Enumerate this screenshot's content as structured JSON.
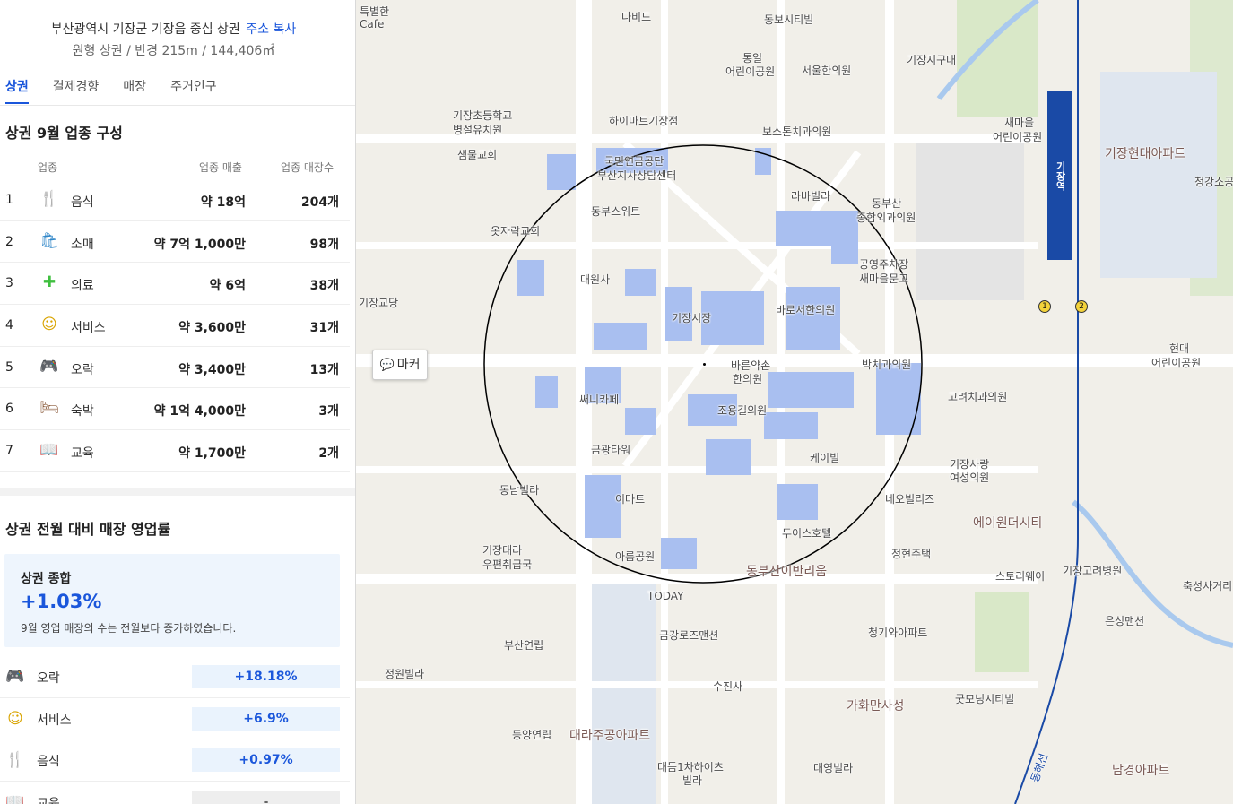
{
  "panel": {
    "address": "부산광역시 기장군 기장읍 중심 상권",
    "copy_label": "주소 복사",
    "subtitle": "원형 상권 / 반경 215m / 144,406㎡",
    "tabs": [
      {
        "label": "상권",
        "active": true
      },
      {
        "label": "결제경향",
        "active": false
      },
      {
        "label": "매장",
        "active": false
      },
      {
        "label": "주거인구",
        "active": false
      }
    ],
    "composition": {
      "title": "상권 9월 업종 구성",
      "headers": {
        "category": "업종",
        "sales": "업종 매출",
        "stores": "업종 매장수"
      },
      "rows": [
        {
          "rank": "1",
          "icon": "food-icon",
          "glyph": "🍴",
          "name": "음식",
          "sales": "약 18억",
          "stores": "204개"
        },
        {
          "rank": "2",
          "icon": "shopping-bag-icon",
          "glyph": "🛍",
          "name": "소매",
          "sales": "약 7억 1,000만",
          "stores": "98개"
        },
        {
          "rank": "3",
          "icon": "medical-cross-icon",
          "glyph": "✚",
          "name": "의료",
          "sales": "약 6억",
          "stores": "38개"
        },
        {
          "rank": "4",
          "icon": "smiley-icon",
          "glyph": "☺",
          "name": "서비스",
          "sales": "약 3,600만",
          "stores": "31개"
        },
        {
          "rank": "5",
          "icon": "gamepad-icon",
          "glyph": "🎮",
          "name": "오락",
          "sales": "약 3,400만",
          "stores": "13개"
        },
        {
          "rank": "6",
          "icon": "bed-icon",
          "glyph": "🛏",
          "name": "숙박",
          "sales": "약 1억 4,000만",
          "stores": "3개"
        },
        {
          "rank": "7",
          "icon": "book-icon",
          "glyph": "📖",
          "name": "교육",
          "sales": "약 1,700만",
          "stores": "2개"
        }
      ]
    },
    "operating": {
      "title": "상권 전월 대비 매장 영업률",
      "summary_title": "상권 종합",
      "summary_value": "+1.03%",
      "summary_desc": "9월 영업 매장의 수는 전월보다 증가하였습니다.",
      "rows": [
        {
          "icon": "gamepad-icon",
          "glyph": "🎮",
          "name": "오락",
          "value": "+18.18%"
        },
        {
          "icon": "smiley-icon",
          "glyph": "☺",
          "name": "서비스",
          "value": "+6.9%"
        },
        {
          "icon": "food-icon",
          "glyph": "🍴",
          "name": "음식",
          "value": "+0.97%"
        },
        {
          "icon": "book-icon",
          "glyph": "📖",
          "name": "교육",
          "value": "-"
        }
      ]
    }
  },
  "map": {
    "marker_button": "마커",
    "station_name": "기장역",
    "exits": [
      "1",
      "2"
    ],
    "labels": [
      {
        "text": "특별한",
        "big": false
      },
      {
        "text": "Cafe",
        "big": false
      },
      {
        "text": "다비드",
        "big": false
      },
      {
        "text": "동보시티빌",
        "big": false
      },
      {
        "text": "통일",
        "big": false
      },
      {
        "text": "어린이공원",
        "big": false
      },
      {
        "text": "서울한의원",
        "big": false
      },
      {
        "text": "기장지구대",
        "big": false
      },
      {
        "text": "기장초등학교",
        "big": false
      },
      {
        "text": "병설유치원",
        "big": false
      },
      {
        "text": "하이마트기장점",
        "big": false
      },
      {
        "text": "보스톤치과의원",
        "big": false
      },
      {
        "text": "새마을",
        "big": false
      },
      {
        "text": "어린이공원",
        "big": false
      },
      {
        "text": "기장현대아파트",
        "big": true
      },
      {
        "text": "청강소공",
        "big": false
      },
      {
        "text": "샘물교회",
        "big": false
      },
      {
        "text": "국민연금공단",
        "big": false
      },
      {
        "text": "부산지사상담센터",
        "big": false
      },
      {
        "text": "라바빌라",
        "big": false
      },
      {
        "text": "동부산",
        "big": false
      },
      {
        "text": "종합외과의원",
        "big": false
      },
      {
        "text": "동부스위트",
        "big": false
      },
      {
        "text": "옷자락교회",
        "big": false
      },
      {
        "text": "공영주차장",
        "big": false
      },
      {
        "text": "새마을문고",
        "big": false
      },
      {
        "text": "대원사",
        "big": false
      },
      {
        "text": "기장교당",
        "big": false
      },
      {
        "text": "기장시장",
        "big": false
      },
      {
        "text": "바로서한의원",
        "big": false
      },
      {
        "text": "현대",
        "big": false
      },
      {
        "text": "어린이공원",
        "big": false
      },
      {
        "text": "바른약손",
        "big": false
      },
      {
        "text": "한의원",
        "big": false
      },
      {
        "text": "박치과의원",
        "big": false
      },
      {
        "text": "써니카페",
        "big": false
      },
      {
        "text": "고려치과의원",
        "big": false
      },
      {
        "text": "조용길의원",
        "big": false
      },
      {
        "text": "금광타워",
        "big": false
      },
      {
        "text": "케이빌",
        "big": false
      },
      {
        "text": "기장사랑",
        "big": false
      },
      {
        "text": "여성의원",
        "big": false
      },
      {
        "text": "동남빌라",
        "big": false
      },
      {
        "text": "이마트",
        "big": false
      },
      {
        "text": "네오빌리즈",
        "big": false
      },
      {
        "text": "에이원더시티",
        "big": true
      },
      {
        "text": "두이스호텔",
        "big": false
      },
      {
        "text": "기장대라",
        "big": false
      },
      {
        "text": "우편취급국",
        "big": false
      },
      {
        "text": "아름공원",
        "big": false
      },
      {
        "text": "동부산이반리움",
        "big": true
      },
      {
        "text": "정현주택",
        "big": false
      },
      {
        "text": "스토리웨이",
        "big": false
      },
      {
        "text": "기장고려병원",
        "big": false
      },
      {
        "text": "축성사거리",
        "big": false
      },
      {
        "text": "TODAY",
        "big": false
      },
      {
        "text": "부산연립",
        "big": false
      },
      {
        "text": "금강로즈맨션",
        "big": false
      },
      {
        "text": "청기와아파트",
        "big": false
      },
      {
        "text": "은성맨션",
        "big": false
      },
      {
        "text": "정원빌라",
        "big": false
      },
      {
        "text": "수진사",
        "big": false
      },
      {
        "text": "굿모닝시티빌",
        "big": false
      },
      {
        "text": "가화만사성",
        "big": true
      },
      {
        "text": "동양연립",
        "big": false
      },
      {
        "text": "대라주공아파트",
        "big": true
      },
      {
        "text": "대듬1차하이츠",
        "big": false
      },
      {
        "text": "빌라",
        "big": false
      },
      {
        "text": "대영빌라",
        "big": false
      },
      {
        "text": "남경아파트",
        "big": true
      },
      {
        "text": "동해선",
        "big": false
      }
    ]
  }
}
